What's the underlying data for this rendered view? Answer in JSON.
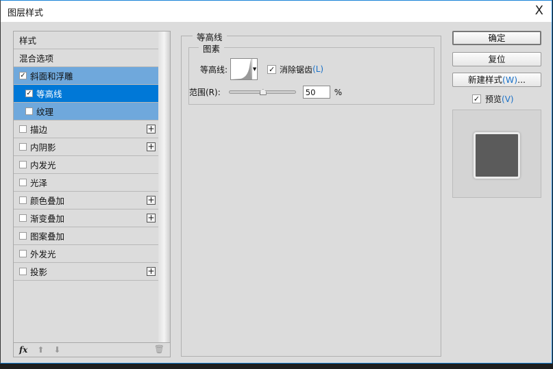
{
  "window": {
    "title": "图层样式",
    "close": "X"
  },
  "styles": [
    {
      "label": "样式",
      "checkbox": false,
      "plus": false
    },
    {
      "label": "混合选项",
      "checkbox": false,
      "plus": false
    },
    {
      "label": "斜面和浮雕",
      "checkbox": true,
      "checked": true,
      "plus": false,
      "state": "parent-selected"
    },
    {
      "label": "等高线",
      "checkbox": true,
      "checked": true,
      "plus": false,
      "state": "selected",
      "sub": true
    },
    {
      "label": "纹理",
      "checkbox": true,
      "checked": false,
      "plus": false,
      "state": "parent-selected",
      "sub": true
    },
    {
      "label": "描边",
      "checkbox": true,
      "checked": false,
      "plus": true
    },
    {
      "label": "内阴影",
      "checkbox": true,
      "checked": false,
      "plus": true
    },
    {
      "label": "内发光",
      "checkbox": true,
      "checked": false,
      "plus": false
    },
    {
      "label": "光泽",
      "checkbox": true,
      "checked": false,
      "plus": false
    },
    {
      "label": "颜色叠加",
      "checkbox": true,
      "checked": false,
      "plus": true
    },
    {
      "label": "渐变叠加",
      "checkbox": true,
      "checked": false,
      "plus": true
    },
    {
      "label": "图案叠加",
      "checkbox": true,
      "checked": false,
      "plus": false
    },
    {
      "label": "外发光",
      "checkbox": true,
      "checked": false,
      "plus": false
    },
    {
      "label": "投影",
      "checkbox": true,
      "checked": false,
      "plus": true
    }
  ],
  "toolbar": {
    "fx": "fx",
    "up": "⬆",
    "down": "⬇",
    "trash": "🗑"
  },
  "panel": {
    "title": "等高线",
    "group": "图素",
    "contour_label": "等高线:",
    "antialias": "消除锯齿",
    "antialias_key": "(L)",
    "antialias_checked": true,
    "range_label": "范围(R):",
    "range_value": "50",
    "range_unit": "%",
    "range_percent": 50
  },
  "buttons": {
    "ok": "确定",
    "reset": "复位",
    "new_style": "新建样式",
    "new_style_key": "(W)",
    "new_style_suffix": "...",
    "preview": "预览",
    "preview_key": "(V)",
    "preview_checked": true
  },
  "colors": {
    "selected": "#0078d7",
    "parent": "#6fa8dc",
    "preview_fill": "#5b5b5b"
  }
}
